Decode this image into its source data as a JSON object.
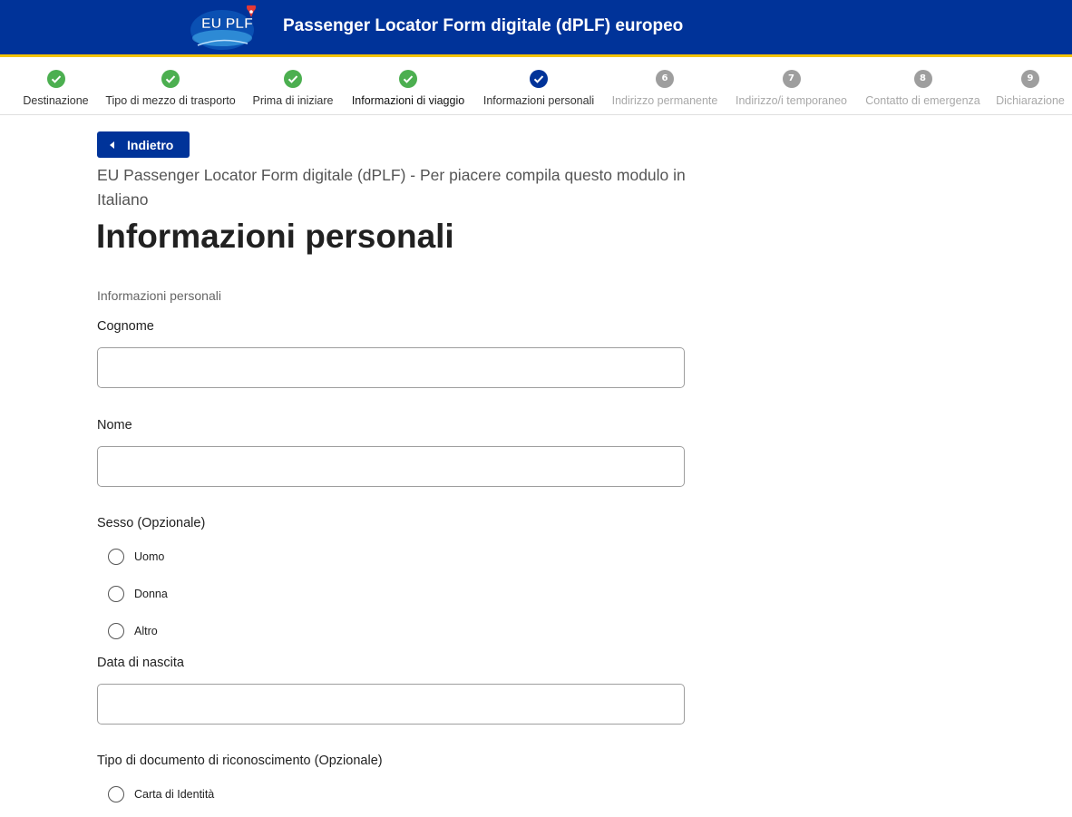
{
  "header": {
    "logo_text": "EU PLF",
    "title": "Passenger Locator Form digitale (dPLF) europeo",
    "colors": {
      "brand_blue": "#003399",
      "stripe_yellow": "#f5c400"
    }
  },
  "stepper": {
    "steps": [
      {
        "label": "Destinazione",
        "state": "done",
        "icon": "check-circle-icon"
      },
      {
        "label": "Tipo di mezzo di trasporto",
        "state": "done",
        "icon": "check-circle-icon"
      },
      {
        "label": "Prima di iniziare",
        "state": "done",
        "icon": "check-circle-icon"
      },
      {
        "label": "Informazioni di viaggio",
        "state": "done",
        "icon": "check-circle-icon"
      },
      {
        "label": "Informazioni personali",
        "state": "current",
        "icon": "check-circle-icon"
      },
      {
        "label": "Indirizzo permanente",
        "state": "pending",
        "number": "6"
      },
      {
        "label": "Indirizzo/i temporaneo",
        "state": "pending",
        "number": "7"
      },
      {
        "label": "Contatto di emergenza",
        "state": "pending",
        "number": "8"
      },
      {
        "label": "Dichiarazione",
        "state": "pending",
        "number": "9"
      }
    ],
    "colors": {
      "done": "#4caf50",
      "current": "#003399",
      "pending": "#9e9e9e"
    }
  },
  "main": {
    "back_label": "Indietro",
    "subtitle": "EU Passenger Locator Form digitale (dPLF) - Per piacere compila questo modulo in Italiano",
    "title": "Informazioni personali",
    "section_label": "Informazioni personali",
    "fields": {
      "surname": {
        "label": "Cognome",
        "value": ""
      },
      "name": {
        "label": "Nome",
        "value": ""
      },
      "gender": {
        "label": "Sesso (Opzionale)",
        "options": [
          "Uomo",
          "Donna",
          "Altro"
        ]
      },
      "birthdate": {
        "label": "Data di nascita",
        "value": ""
      },
      "document_type": {
        "label": "Tipo di documento di riconoscimento (Opzionale)",
        "options": [
          "Carta di Identità"
        ]
      }
    }
  }
}
